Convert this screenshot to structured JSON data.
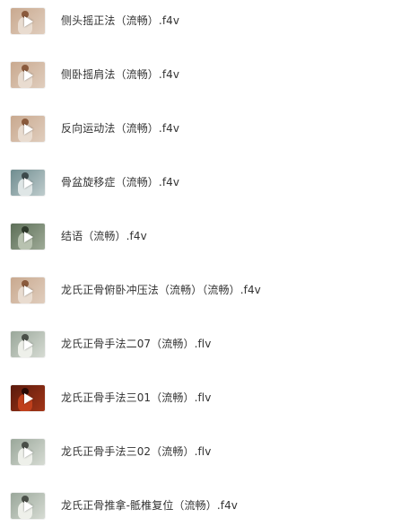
{
  "files": [
    {
      "name": "侧头摇正法（流畅）.f4v",
      "thumb": "warm-room"
    },
    {
      "name": "侧卧摇肩法（流畅）.f4v",
      "thumb": "warm-room"
    },
    {
      "name": "反向运动法（流畅）.f4v",
      "thumb": "warm-room"
    },
    {
      "name": "骨盆旋移症（流畅）.f4v",
      "thumb": "clinic-blue"
    },
    {
      "name": "结语（流畅）.f4v",
      "thumb": "clinic-green"
    },
    {
      "name": "龙氏正骨俯卧冲压法（流畅）（流畅）.f4v",
      "thumb": "warm-room"
    },
    {
      "name": "龙氏正骨手法二07（流畅）.flv",
      "thumb": "clinic-light"
    },
    {
      "name": "龙氏正骨手法三01（流畅）.flv",
      "thumb": "dark-red"
    },
    {
      "name": "龙氏正骨手法三02（流畅）.flv",
      "thumb": "clinic-light"
    },
    {
      "name": "龙氏正骨推拿-骶椎复位（流畅）.f4v",
      "thumb": "clinic-light"
    }
  ],
  "thumb_palettes": {
    "warm-room": {
      "bg": "#c9a98f",
      "figure": "#e9dcd0",
      "head": "#8a5a3c"
    },
    "clinic-blue": {
      "bg": "#6f8c8f",
      "figure": "#dfe6e6",
      "head": "#3d4a4c"
    },
    "clinic-green": {
      "bg": "#5d6f58",
      "figure": "#b8c2b0",
      "head": "#2f3a2c"
    },
    "clinic-light": {
      "bg": "#9aa79a",
      "figure": "#eef0ea",
      "head": "#4a4f48"
    },
    "dark-red": {
      "bg": "#5a1a0c",
      "figure": "#c0401c",
      "head": "#2a0a04"
    }
  },
  "icons": {
    "thumbnail_overlay": "play-icon"
  }
}
